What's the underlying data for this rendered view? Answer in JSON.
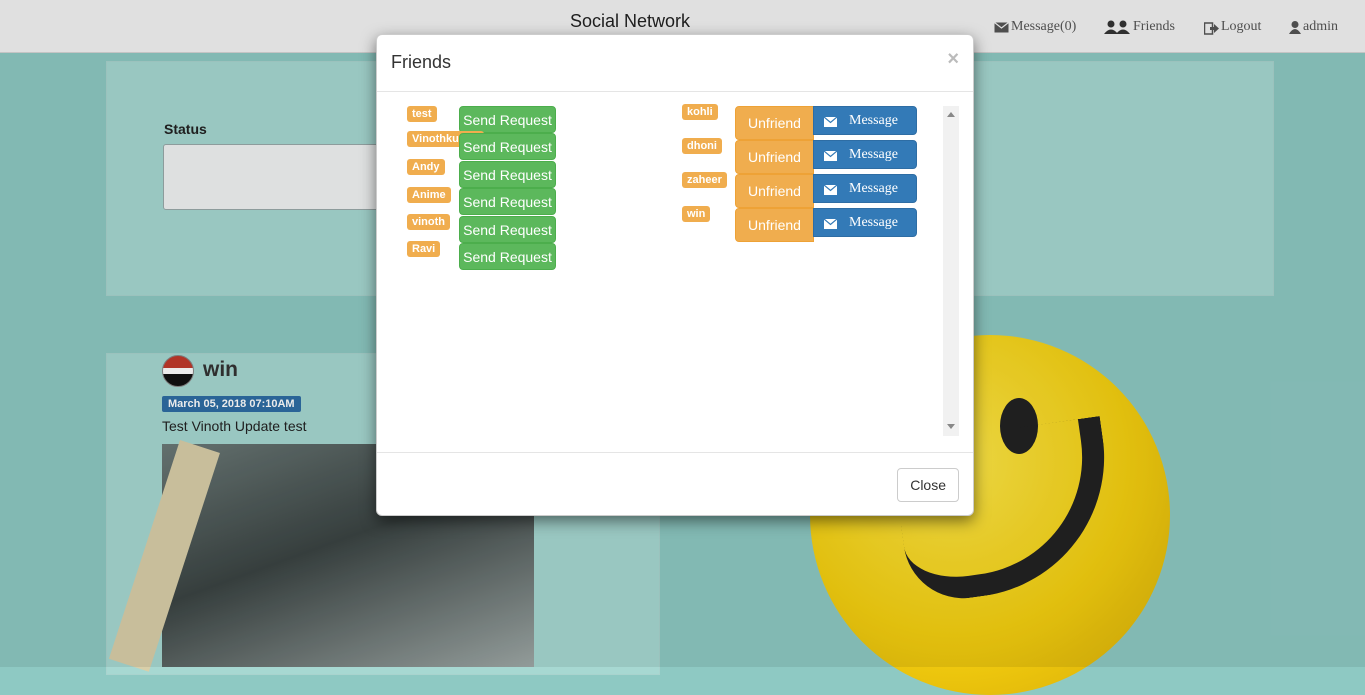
{
  "header": {
    "brand": "Social Network",
    "nav": {
      "message": "Message(0)",
      "friends": "Friends",
      "logout": "Logout",
      "user": "admin"
    }
  },
  "background": {
    "status_label": "Status",
    "post": {
      "author": "win",
      "date": "March 05, 2018 07:10AM",
      "text": "Test Vinoth Update test"
    }
  },
  "modal": {
    "title": "Friends",
    "close_x": "×",
    "close_label": "Close",
    "suggestions": [
      {
        "name": "test",
        "action": "Send Request"
      },
      {
        "name": "Vinothkumar",
        "action": "Send Request"
      },
      {
        "name": "Andy",
        "action": "Send Request"
      },
      {
        "name": "Anime",
        "action": "Send Request"
      },
      {
        "name": "vinoth",
        "action": "Send Request"
      },
      {
        "name": "Ravi",
        "action": "Send Request"
      }
    ],
    "friends": [
      {
        "name": "kohli",
        "unfriend": "Unfriend",
        "message": "Message"
      },
      {
        "name": "dhoni",
        "unfriend": "Unfriend",
        "message": "Message"
      },
      {
        "name": "zaheer",
        "unfriend": "Unfriend",
        "message": "Message"
      },
      {
        "name": "win",
        "unfriend": "Unfriend",
        "message": "Message"
      }
    ]
  },
  "colors": {
    "label_warning": "#f0ad4e",
    "success": "#5cb85c",
    "primary": "#337ab7"
  }
}
